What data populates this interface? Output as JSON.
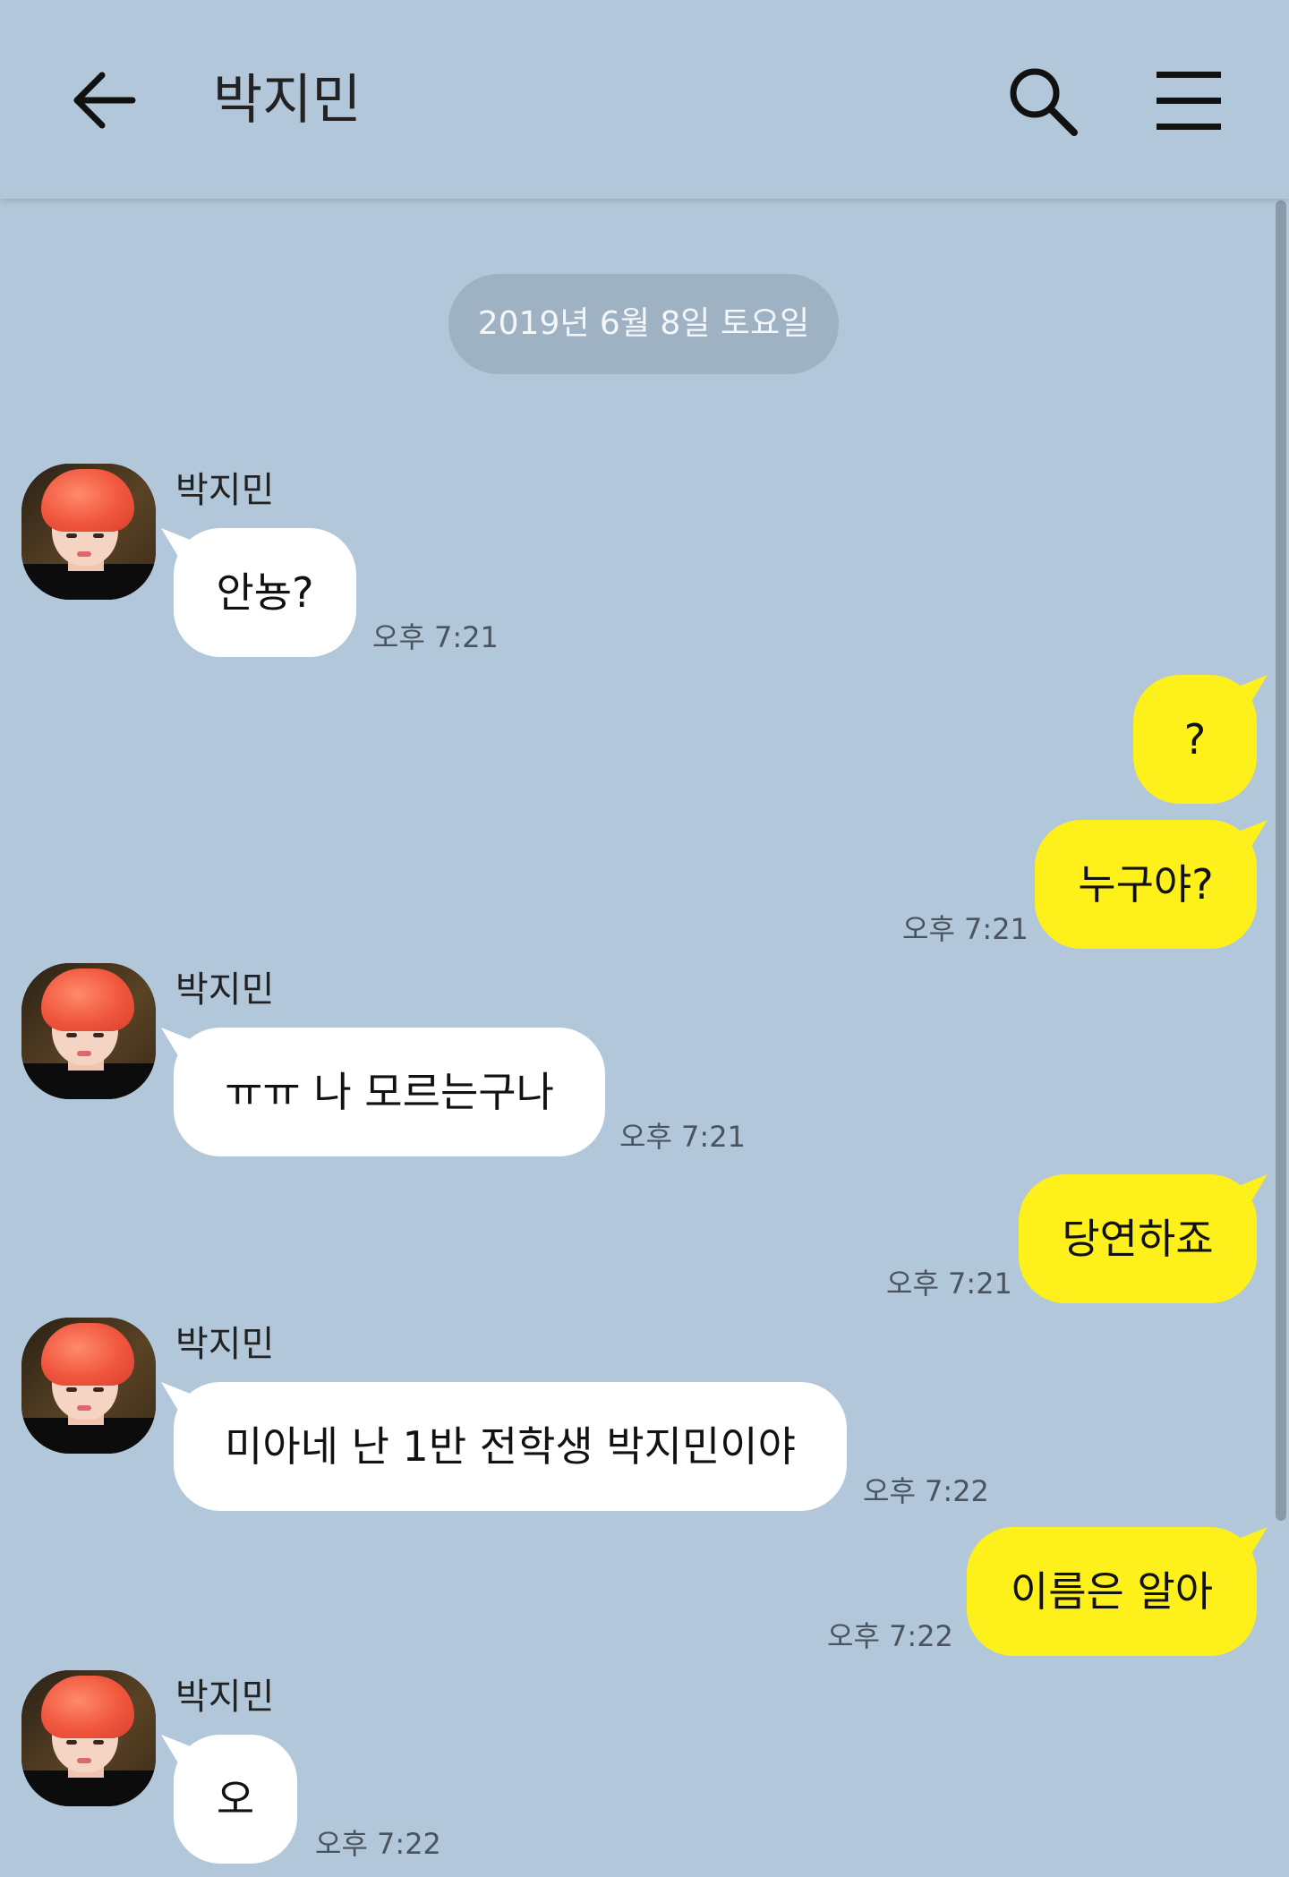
{
  "header": {
    "title": "박지민",
    "back_icon": "arrow-left-icon",
    "search_icon": "search-icon",
    "menu_icon": "hamburger-menu-icon"
  },
  "date_divider": "2019년 6월 8일 토요일",
  "colors": {
    "background": "#b2c7da",
    "incoming_bubble": "#ffffff",
    "outgoing_bubble": "#fef01b",
    "date_pill": "#9fb2c4"
  },
  "messages": [
    {
      "from": "박지민",
      "direction": "in",
      "text": "안뇽?",
      "time": "오후 7:21"
    },
    {
      "direction": "out",
      "text": "?"
    },
    {
      "direction": "out",
      "text": "누구야?",
      "time": "오후 7:21"
    },
    {
      "from": "박지민",
      "direction": "in",
      "text": "ㅠㅠ 나 모르는구나",
      "time": "오후 7:21"
    },
    {
      "direction": "out",
      "text": "당연하죠",
      "time": "오후 7:21"
    },
    {
      "from": "박지민",
      "direction": "in",
      "text": "미아네 난 1반 전학생 박지민이야",
      "time": "오후 7:22"
    },
    {
      "direction": "out",
      "text": "이름은 알아",
      "time": "오후 7:22"
    },
    {
      "from": "박지민",
      "direction": "in",
      "text": "오",
      "time": "오후 7:22"
    }
  ]
}
